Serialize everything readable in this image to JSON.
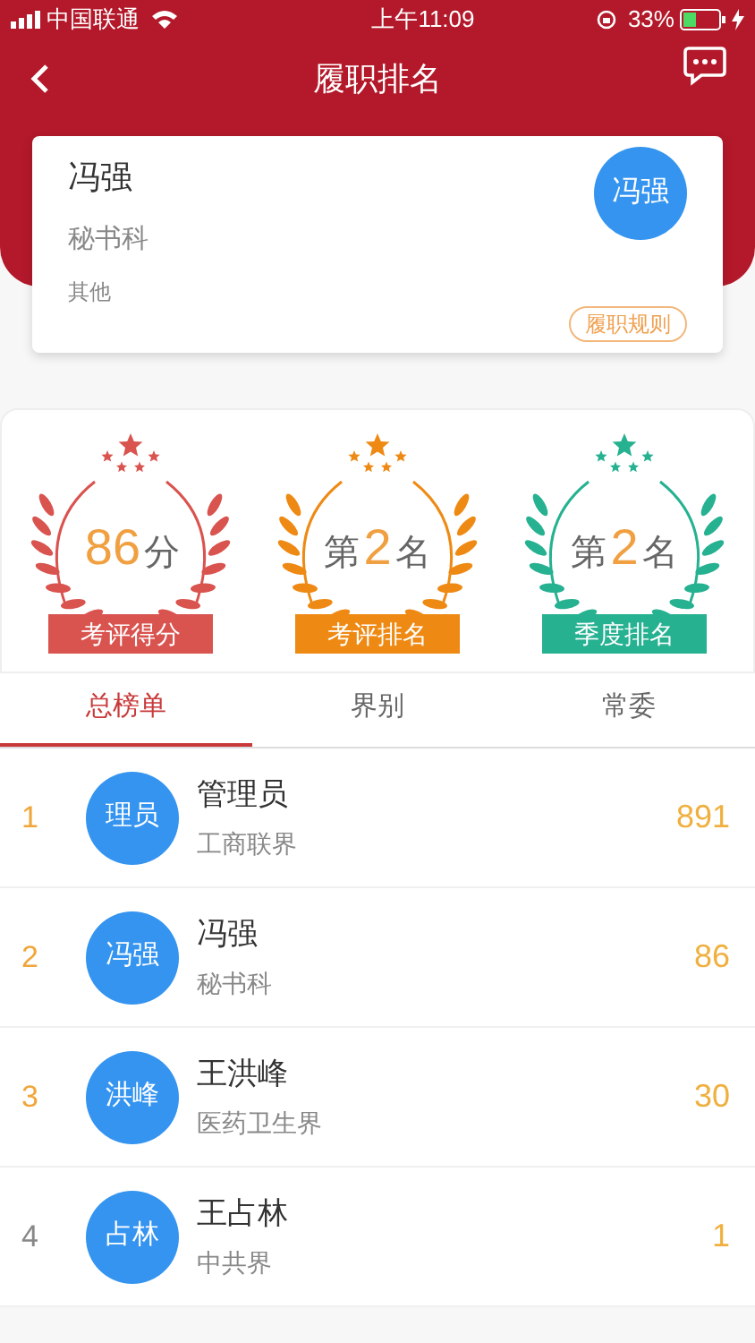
{
  "status_bar": {
    "carrier": "中国联通",
    "time": "上午11:09",
    "battery": "33%"
  },
  "nav": {
    "title": "履职排名"
  },
  "profile": {
    "name": "冯强",
    "department": "秘书科",
    "group": "其他",
    "avatar": "冯强",
    "rules_button": "履职规则"
  },
  "awards": [
    {
      "value": "86",
      "suffix": "分",
      "label": "考评得分",
      "color": "#d9534f"
    },
    {
      "prefix": "第",
      "value": "2",
      "suffix": "名",
      "label": "考评排名",
      "color": "#ee8a14"
    },
    {
      "prefix": "第",
      "value": "2",
      "suffix": "名",
      "label": "季度排名",
      "color": "#26b191"
    }
  ],
  "tabs": [
    {
      "label": "总榜单",
      "selected": true
    },
    {
      "label": "界别",
      "selected": false
    },
    {
      "label": "常委",
      "selected": false
    }
  ],
  "rows": [
    {
      "rank": "1",
      "highlighted": true,
      "avatar": "理员",
      "name": "管理员",
      "group": "工商联界",
      "score": "891"
    },
    {
      "rank": "2",
      "highlighted": true,
      "avatar": "冯强",
      "name": "冯强",
      "group": "秘书科",
      "score": "86"
    },
    {
      "rank": "3",
      "highlighted": true,
      "avatar": "洪峰",
      "name": "王洪峰",
      "group": "医药卫生界",
      "score": "30"
    },
    {
      "rank": "4",
      "highlighted": false,
      "avatar": "占林",
      "name": "王占林",
      "group": "中共界",
      "score": "1"
    }
  ]
}
